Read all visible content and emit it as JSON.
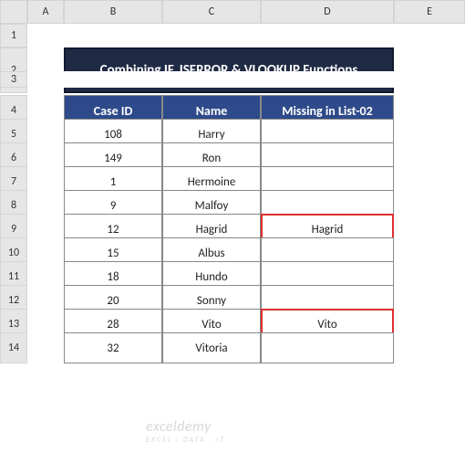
{
  "columns": [
    "A",
    "B",
    "C",
    "D",
    "E"
  ],
  "rows": [
    "1",
    "2",
    "3",
    "4",
    "5",
    "6",
    "7",
    "8",
    "9",
    "10",
    "11",
    "12",
    "13",
    "14"
  ],
  "title": "Combining IF, ISERROR & VLOOKUP Functions",
  "headers": {
    "col1": "Case ID",
    "col2": "Name",
    "col3": "Missing in List-02"
  },
  "data": [
    {
      "case_id": "108",
      "name": "Harry",
      "missing": ""
    },
    {
      "case_id": "149",
      "name": "Ron",
      "missing": ""
    },
    {
      "case_id": "1",
      "name": "Hermoine",
      "missing": ""
    },
    {
      "case_id": "9",
      "name": "Malfoy",
      "missing": ""
    },
    {
      "case_id": "12",
      "name": "Hagrid",
      "missing": "Hagrid"
    },
    {
      "case_id": "15",
      "name": "Albus",
      "missing": ""
    },
    {
      "case_id": "18",
      "name": "Hundo",
      "missing": ""
    },
    {
      "case_id": "20",
      "name": "Sonny",
      "missing": ""
    },
    {
      "case_id": "28",
      "name": "Vito",
      "missing": "Vito"
    },
    {
      "case_id": "32",
      "name": "Vitoria",
      "missing": ""
    }
  ],
  "watermark": {
    "main": "exceldemy",
    "sub": "EXCEL · DATA · IT"
  }
}
